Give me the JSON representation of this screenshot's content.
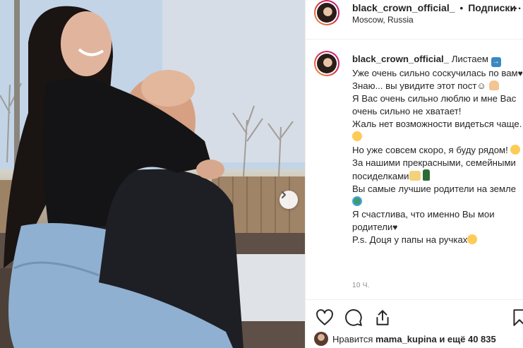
{
  "post": {
    "username": "black_crown_official_",
    "separator": "•",
    "follow_label": "Подписки",
    "location": "Moscow, Russia",
    "more_label": "...",
    "caption_lines": [
      "Листаем",
      "Уже очень сильно соскучилась по вам",
      "Знаю... вы увидите этот пост",
      "Я Вас очень сильно люблю и мне Вас очень сильно не хватает!",
      "Жаль нет возможности видеться чаще.",
      "Но уже совсем скоро, я буду рядом!",
      "За нашими прекрасными, семейными посиделками",
      "Вы самые лучшие родители на земле",
      "Я счастлива, что именно Вы мои родители",
      "P.s. Доця у папы на ручках"
    ],
    "time_ago": "10 ч.",
    "likes": {
      "prefix": "Нравится",
      "user": "mama_kupina",
      "suffix": "и ещё 40 835"
    }
  },
  "icons": {
    "arrow": "right-arrow-emoji-icon",
    "smile": "smile-emoji-icon",
    "pray": "praying-hands-emoji-icon",
    "earth": "globe-emoji-icon",
    "clink": "clinking-glasses-emoji-icon",
    "bottle": "champagne-bottle-emoji-icon",
    "heart": "heart-icon",
    "comment": "comment-icon",
    "share": "share-icon",
    "bookmark": "bookmark-icon",
    "next": "next-photo-arrow-icon"
  },
  "colors": {
    "text": "#262626",
    "muted": "#8e8e8e",
    "border": "#efefef",
    "story_ring": "#dc2743"
  }
}
